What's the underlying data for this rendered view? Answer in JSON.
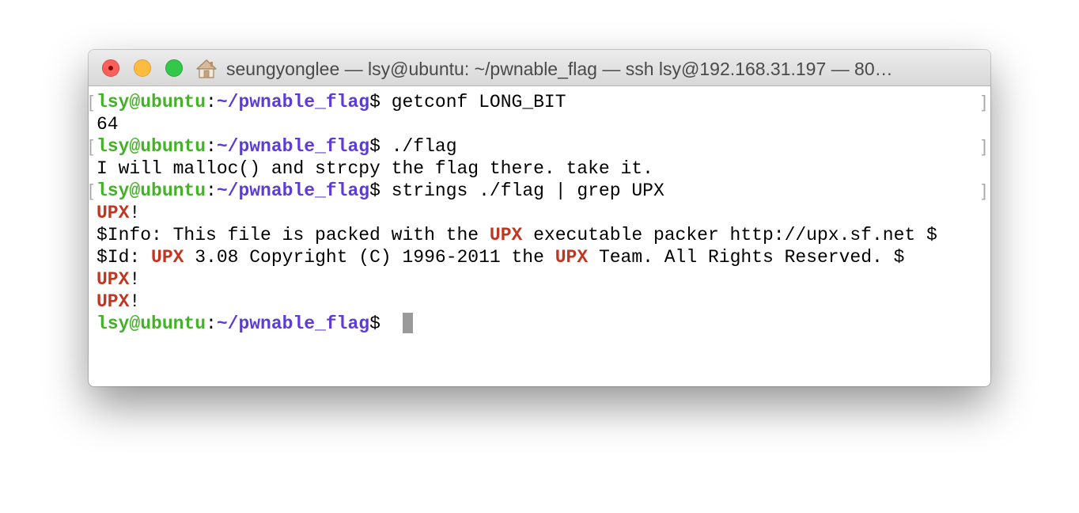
{
  "window": {
    "title": "seungyonglee — lsy@ubuntu: ~/pwnable_flag — ssh lsy@192.168.31.197 — 80…",
    "icon": "home-icon",
    "colors": {
      "prompt_user": "#43b226",
      "prompt_path": "#5c3bd6",
      "grep_highlight": "#c23621",
      "close": "#fc605c",
      "minimize": "#fdbc40",
      "maximize": "#34c84a"
    }
  },
  "prompt": {
    "user": "lsy@ubuntu",
    "sep": ":",
    "path": "~/pwnable_flag",
    "symbol": "$ "
  },
  "marks": {
    "open": "[",
    "close": "]"
  },
  "terminal": {
    "cmd1": "getconf LONG_BIT",
    "out1": "64",
    "cmd2": "./flag",
    "out2": "I will malloc() and strcpy the flag there. take it.",
    "cmd3": "strings ./flag | grep UPX",
    "upx": "UPX",
    "bang": "!",
    "info_pre": "$Info: This file is packed with the ",
    "info_post": " executable packer http://upx.sf.net $",
    "id_pre": "$Id: ",
    "id_mid": " 3.08 Copyright (C) 1996-2011 the ",
    "id_post": " Team. All Rights Reserved. $"
  }
}
